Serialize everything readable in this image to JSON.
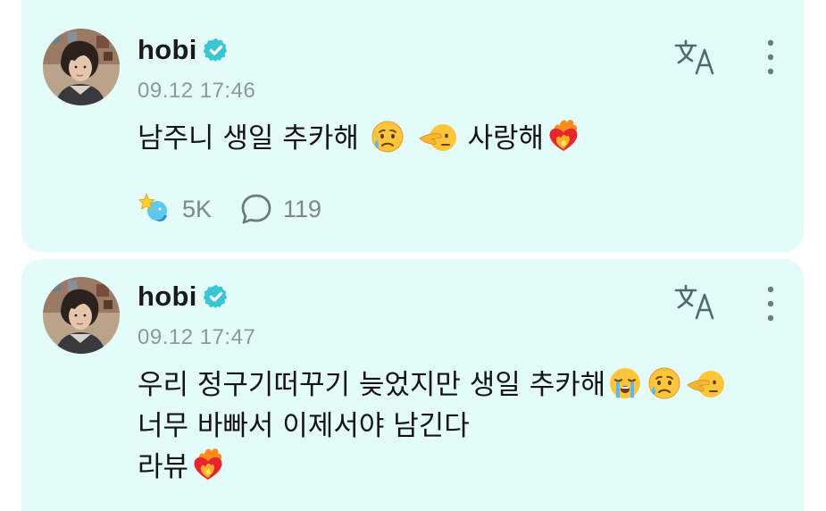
{
  "posts": [
    {
      "author": "hobi",
      "timestamp": "09.12 17:46",
      "lines": [
        {
          "text": "남주니 생일 추카해 ",
          "emojis_after": [
            "crying-face",
            "pointing-hand-face"
          ],
          "tail": " 사랑해",
          "tail_emoji": "heart-on-fire"
        }
      ],
      "likes": "5K",
      "comments": "119"
    },
    {
      "author": "hobi",
      "timestamp": "09.12 17:47",
      "line1": "우리 정구기떠꾸기 늦었지만 생일 추카해",
      "line2": "너무 바빠서 이제서야 남긴다",
      "line3": "라뷰"
    }
  ],
  "icons": {
    "verified": "verified-badge-icon",
    "translate": "translate-icon",
    "more": "more-vertical-icon",
    "like": "sparkle-like-icon",
    "comment": "comment-bubble-icon"
  },
  "colors": {
    "card_bg": "#e3fbf9",
    "verified": "#38c6d4",
    "muted": "#8a9a9a"
  }
}
